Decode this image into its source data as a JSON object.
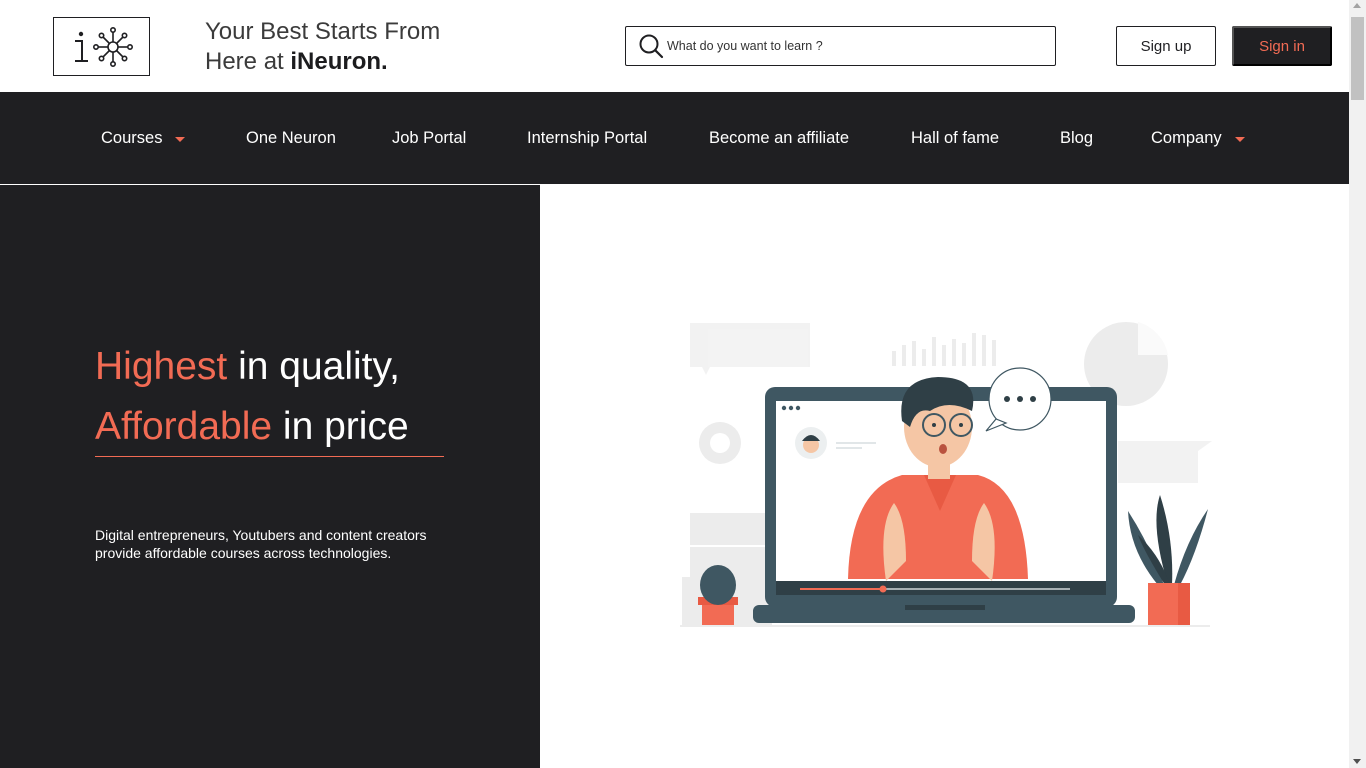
{
  "header": {
    "logo_icon": "ineuron-logo-icon",
    "tagline_line1": "Your Best Starts From",
    "tagline_line2_prefix": "Here at ",
    "tagline_brand": "iNeuron."
  },
  "search": {
    "icon": "search-icon",
    "placeholder": "What do you want to learn ?"
  },
  "auth": {
    "signup_label": "Sign up",
    "signin_label": "Sign in"
  },
  "nav": {
    "items": [
      {
        "label": "Courses",
        "has_dropdown": true
      },
      {
        "label": "One Neuron",
        "has_dropdown": false
      },
      {
        "label": "Job Portal",
        "has_dropdown": false
      },
      {
        "label": "Internship Portal",
        "has_dropdown": false
      },
      {
        "label": "Become an affiliate",
        "has_dropdown": false
      },
      {
        "label": "Hall of fame",
        "has_dropdown": false
      },
      {
        "label": "Blog",
        "has_dropdown": false
      },
      {
        "label": "Company",
        "has_dropdown": true
      }
    ]
  },
  "hero": {
    "line1_accent": "Highest",
    "line1_rest": " in quality,",
    "line2_accent": "Affordable",
    "line2_rest": " in price",
    "description": "Digital entrepreneurs, Youtubers and content creators provide affordable courses across technologies.",
    "illustration": "online-teacher-illustration"
  },
  "colors": {
    "brand_dark": "#1f1f22",
    "accent": "#f26b54",
    "white": "#ffffff"
  }
}
